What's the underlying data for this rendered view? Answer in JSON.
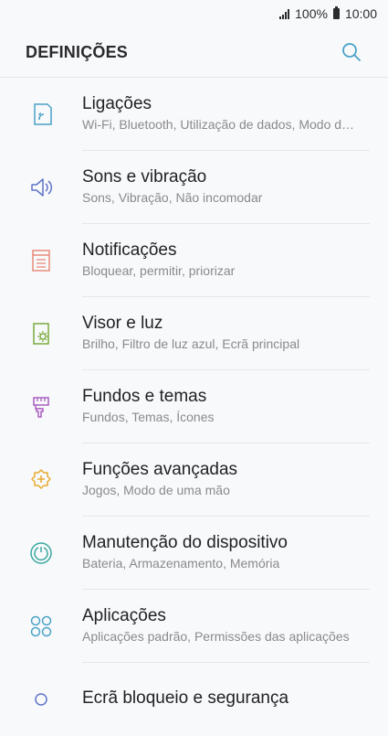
{
  "status_bar": {
    "battery_percent": "100%",
    "time": "10:00"
  },
  "header": {
    "title": "DEFINIÇÕES",
    "search_icon": "search-icon"
  },
  "colors": {
    "accent": "#4aa3c8"
  },
  "items": [
    {
      "title": "Ligações",
      "subtitle": "Wi-Fi, Bluetooth, Utilização de dados, Modo de voo",
      "icon": "connections-icon",
      "color": "#4aa3c8"
    },
    {
      "title": "Sons e vibração",
      "subtitle": "Sons, Vibração, Não incomodar",
      "icon": "sound-icon",
      "color": "#5e74c9"
    },
    {
      "title": "Notificações",
      "subtitle": "Bloquear, permitir, priorizar",
      "icon": "notifications-icon",
      "color": "#e88a7a"
    },
    {
      "title": "Visor e luz",
      "subtitle": "Brilho, Filtro de luz azul, Ecrã principal",
      "icon": "display-icon",
      "color": "#7bab3d"
    },
    {
      "title": "Fundos e temas",
      "subtitle": "Fundos, Temas, Ícones",
      "icon": "wallpaper-icon",
      "color": "#a85ec0"
    },
    {
      "title": "Funções avançadas",
      "subtitle": "Jogos, Modo de uma mão",
      "icon": "advanced-icon",
      "color": "#e7ab2f"
    },
    {
      "title": "Manutenção do dispositivo",
      "subtitle": "Bateria, Armazenamento, Memória",
      "icon": "maintenance-icon",
      "color": "#3aa8a0"
    },
    {
      "title": "Aplicações",
      "subtitle": "Aplicações padrão, Permissões das aplicações",
      "icon": "apps-icon",
      "color": "#4aa3c8"
    },
    {
      "title": "Ecrã bloqueio e segurança",
      "subtitle": "",
      "icon": "lock-screen-icon",
      "color": "#5e74c9"
    }
  ]
}
